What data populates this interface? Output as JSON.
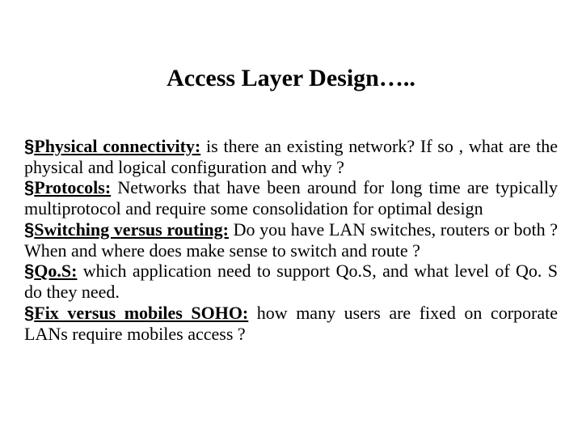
{
  "title": "Access Layer Design…..",
  "bullets": [
    {
      "heading": "Physical connectivity:",
      "text": " is there an existing network? If so , what are the physical and logical configuration and why ?"
    },
    {
      "heading": "Protocols:",
      "text": " Networks that have been around for long time are typically multiprotocol and require some consolidation for optimal design"
    },
    {
      "heading": "Switching versus routing:",
      "text": " Do you have LAN switches, routers or both ? When and where does make sense to switch and route ?"
    },
    {
      "heading": "Qo.S:",
      "text": " which application need to support Qo.S, and what level of Qo. S do they need."
    },
    {
      "heading": "Fix versus mobiles SOHO:",
      "text": " how many users are fixed on corporate LANs require mobiles access ?"
    }
  ],
  "bullet_glyph": "§"
}
